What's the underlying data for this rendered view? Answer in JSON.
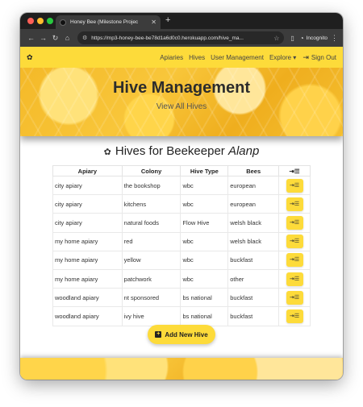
{
  "browser": {
    "tab_title": "Honey Bee (Milestone Projec",
    "tab_close": "✕",
    "new_tab": "+",
    "url": "https://mp3-honey-bee-be78d1a6d0c0.herokuapp.com/hive_ma...",
    "incognito_label": "Incognito",
    "buttons": {
      "back": "←",
      "forward": "→",
      "reload": "↻",
      "home": "⌂",
      "star": "☆",
      "menu": "⋮"
    },
    "icons": {
      "tab": "favicon",
      "site_info": "tune-icon",
      "sidebar": "sidebar-icon",
      "incognito": "incognito-icon"
    }
  },
  "navbar": {
    "brand_icon": "✿",
    "links": [
      "Apiaries",
      "Hives",
      "User Management",
      "Explore ▾",
      "Sign Out"
    ],
    "signout_icon": "⇥",
    "color": "#fddb3a"
  },
  "hero": {
    "title": "Hive Management",
    "subtitle": "View All Hives"
  },
  "section": {
    "icon": "✿",
    "title_prefix": "Hives for Beekeeper ",
    "title_user": "Alanp"
  },
  "table": {
    "headers": [
      "Apiary",
      "Colony",
      "Hive Type",
      "Bees",
      "⇥☰"
    ],
    "rows": [
      [
        "city apiary",
        "the bookshop",
        "wbc",
        "european"
      ],
      [
        "city apiary",
        "kitchens",
        "wbc",
        "european"
      ],
      [
        "city apiary",
        "natural foods",
        "Flow Hive",
        "welsh black"
      ],
      [
        "my home apiary",
        "red",
        "wbc",
        "welsh black"
      ],
      [
        "my home apiary",
        "yellow",
        "wbc",
        "buckfast"
      ],
      [
        "my home apiary",
        "patchwork",
        "wbc",
        "other"
      ],
      [
        "woodland apiary",
        "nt sponsored",
        "bs national",
        "buckfast"
      ],
      [
        "woodland apiary",
        "ivy hive",
        "bs national",
        "buckfast"
      ]
    ],
    "action_label": "⇥☰"
  },
  "add_button": {
    "icon": "+",
    "label": "Add New Hive"
  }
}
